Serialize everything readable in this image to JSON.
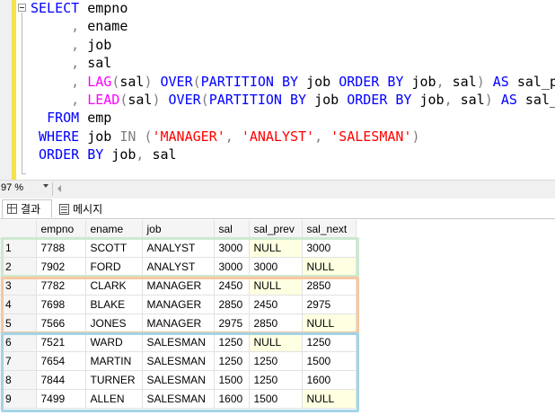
{
  "editor": {
    "lines": [
      [
        {
          "t": "SELECT",
          "c": "kw"
        },
        {
          "t": " empno",
          "c": "tx"
        }
      ],
      [
        {
          "t": "     ",
          "c": "tx"
        },
        {
          "t": ",",
          "c": "op"
        },
        {
          "t": " ename",
          "c": "tx"
        }
      ],
      [
        {
          "t": "     ",
          "c": "tx"
        },
        {
          "t": ",",
          "c": "op"
        },
        {
          "t": " job",
          "c": "tx"
        }
      ],
      [
        {
          "t": "     ",
          "c": "tx"
        },
        {
          "t": ",",
          "c": "op"
        },
        {
          "t": " sal",
          "c": "tx"
        }
      ],
      [
        {
          "t": "     ",
          "c": "tx"
        },
        {
          "t": ",",
          "c": "op"
        },
        {
          "t": " ",
          "c": "tx"
        },
        {
          "t": "LAG",
          "c": "fn"
        },
        {
          "t": "(",
          "c": "op"
        },
        {
          "t": "sal",
          "c": "tx"
        },
        {
          "t": ")",
          "c": "op"
        },
        {
          "t": " ",
          "c": "tx"
        },
        {
          "t": "OVER",
          "c": "kw"
        },
        {
          "t": "(",
          "c": "op"
        },
        {
          "t": "PARTITION BY",
          "c": "kw"
        },
        {
          "t": " job ",
          "c": "tx"
        },
        {
          "t": "ORDER BY",
          "c": "kw"
        },
        {
          "t": " job",
          "c": "tx"
        },
        {
          "t": ",",
          "c": "op"
        },
        {
          "t": " sal",
          "c": "tx"
        },
        {
          "t": ")",
          "c": "op"
        },
        {
          "t": " ",
          "c": "tx"
        },
        {
          "t": "AS",
          "c": "kw"
        },
        {
          "t": " sal_prev",
          "c": "tx"
        }
      ],
      [
        {
          "t": "     ",
          "c": "tx"
        },
        {
          "t": ",",
          "c": "op"
        },
        {
          "t": " ",
          "c": "tx"
        },
        {
          "t": "LEAD",
          "c": "fn"
        },
        {
          "t": "(",
          "c": "op"
        },
        {
          "t": "sal",
          "c": "tx"
        },
        {
          "t": ")",
          "c": "op"
        },
        {
          "t": " ",
          "c": "tx"
        },
        {
          "t": "OVER",
          "c": "kw"
        },
        {
          "t": "(",
          "c": "op"
        },
        {
          "t": "PARTITION BY",
          "c": "kw"
        },
        {
          "t": " job ",
          "c": "tx"
        },
        {
          "t": "ORDER BY",
          "c": "kw"
        },
        {
          "t": " job",
          "c": "tx"
        },
        {
          "t": ",",
          "c": "op"
        },
        {
          "t": " sal",
          "c": "tx"
        },
        {
          "t": ")",
          "c": "op"
        },
        {
          "t": " ",
          "c": "tx"
        },
        {
          "t": "AS",
          "c": "kw"
        },
        {
          "t": " sal_next",
          "c": "tx"
        }
      ],
      [
        {
          "t": "  ",
          "c": "tx"
        },
        {
          "t": "FROM",
          "c": "kw"
        },
        {
          "t": " emp",
          "c": "tx"
        }
      ],
      [
        {
          "t": " ",
          "c": "tx"
        },
        {
          "t": "WHERE",
          "c": "kw"
        },
        {
          "t": " job ",
          "c": "tx"
        },
        {
          "t": "IN",
          "c": "op"
        },
        {
          "t": " ",
          "c": "tx"
        },
        {
          "t": "(",
          "c": "op"
        },
        {
          "t": "'MANAGER'",
          "c": "str"
        },
        {
          "t": ",",
          "c": "op"
        },
        {
          "t": " ",
          "c": "tx"
        },
        {
          "t": "'ANALYST'",
          "c": "str"
        },
        {
          "t": ",",
          "c": "op"
        },
        {
          "t": " ",
          "c": "tx"
        },
        {
          "t": "'SALESMAN'",
          "c": "str"
        },
        {
          "t": ")",
          "c": "op"
        }
      ],
      [
        {
          "t": " ",
          "c": "tx"
        },
        {
          "t": "ORDER BY",
          "c": "kw"
        },
        {
          "t": " job",
          "c": "tx"
        },
        {
          "t": ",",
          "c": "op"
        },
        {
          "t": " sal",
          "c": "tx"
        }
      ]
    ]
  },
  "zoom": {
    "value": "97 %"
  },
  "tabs": {
    "results_label": "결과",
    "messages_label": "메시지"
  },
  "grid": {
    "columns": [
      "",
      "empno",
      "ename",
      "job",
      "sal",
      "sal_prev",
      "sal_next"
    ],
    "rows": [
      [
        "1",
        "7788",
        "SCOTT",
        "ANALYST",
        "3000",
        "NULL",
        "3000"
      ],
      [
        "2",
        "7902",
        "FORD",
        "ANALYST",
        "3000",
        "3000",
        "NULL"
      ],
      [
        "3",
        "7782",
        "CLARK",
        "MANAGER",
        "2450",
        "NULL",
        "2850"
      ],
      [
        "4",
        "7698",
        "BLAKE",
        "MANAGER",
        "2850",
        "2450",
        "2975"
      ],
      [
        "5",
        "7566",
        "JONES",
        "MANAGER",
        "2975",
        "2850",
        "NULL"
      ],
      [
        "6",
        "7521",
        "WARD",
        "SALESMAN",
        "1250",
        "NULL",
        "1250"
      ],
      [
        "7",
        "7654",
        "MARTIN",
        "SALESMAN",
        "1250",
        "1250",
        "1500"
      ],
      [
        "8",
        "7844",
        "TURNER",
        "SALESMAN",
        "1500",
        "1250",
        "1600"
      ],
      [
        "9",
        "7499",
        "ALLEN",
        "SALESMAN",
        "1600",
        "1500",
        "NULL"
      ]
    ],
    "null_text": "NULL",
    "groups": [
      {
        "label": "ANALYST",
        "color": "#cde9cf"
      },
      {
        "label": "MANAGER",
        "color": "#f7c7a0"
      },
      {
        "label": "SALESMAN",
        "color": "#a3d4e6"
      }
    ]
  },
  "colors": {
    "keyword": "#0000ff",
    "function": "#ff00ff",
    "string": "#ff0000",
    "operator": "#808080",
    "null_cell": "#ffffe1"
  }
}
